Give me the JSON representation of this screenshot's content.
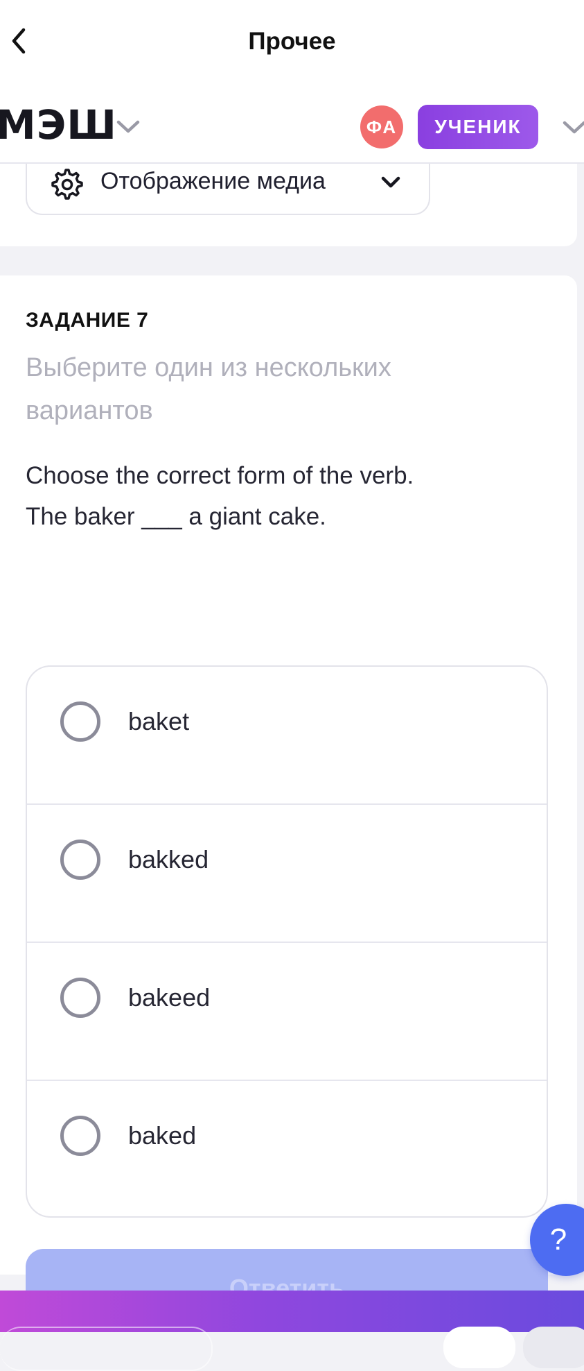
{
  "nav": {
    "title": "Прочее"
  },
  "brand": {
    "logo_text": "МЭШ",
    "avatar_initials": "ФА",
    "role_label": "УЧЕНИК"
  },
  "media": {
    "label": "Отображение медиа"
  },
  "task": {
    "number_label": "ЗАДАНИЕ 7",
    "instruction": "Выберите один из нескольких вариантов",
    "question_line1": "Choose the correct form of the verb.",
    "question_line2": "The baker ___ a giant cake.",
    "options": [
      {
        "label": "baket",
        "selected": false
      },
      {
        "label": "bakked",
        "selected": false
      },
      {
        "label": "bakeed",
        "selected": false
      },
      {
        "label": "baked",
        "selected": false
      }
    ],
    "answer_button": "Ответить"
  },
  "help": {
    "label": "?"
  },
  "colors": {
    "accent_purple": "#8a3fe0",
    "avatar_red": "#f26d6d",
    "answer_button": "#a7b4f5",
    "help_blue": "#4d6cf2"
  },
  "icons": {
    "back": "chevron-left-icon",
    "logo_dropdown": "chevron-down-icon",
    "role_dropdown": "chevron-down-icon",
    "media": "gear-icon",
    "media_dropdown": "chevron-down-icon",
    "radio": "radio-unchecked-icon"
  }
}
